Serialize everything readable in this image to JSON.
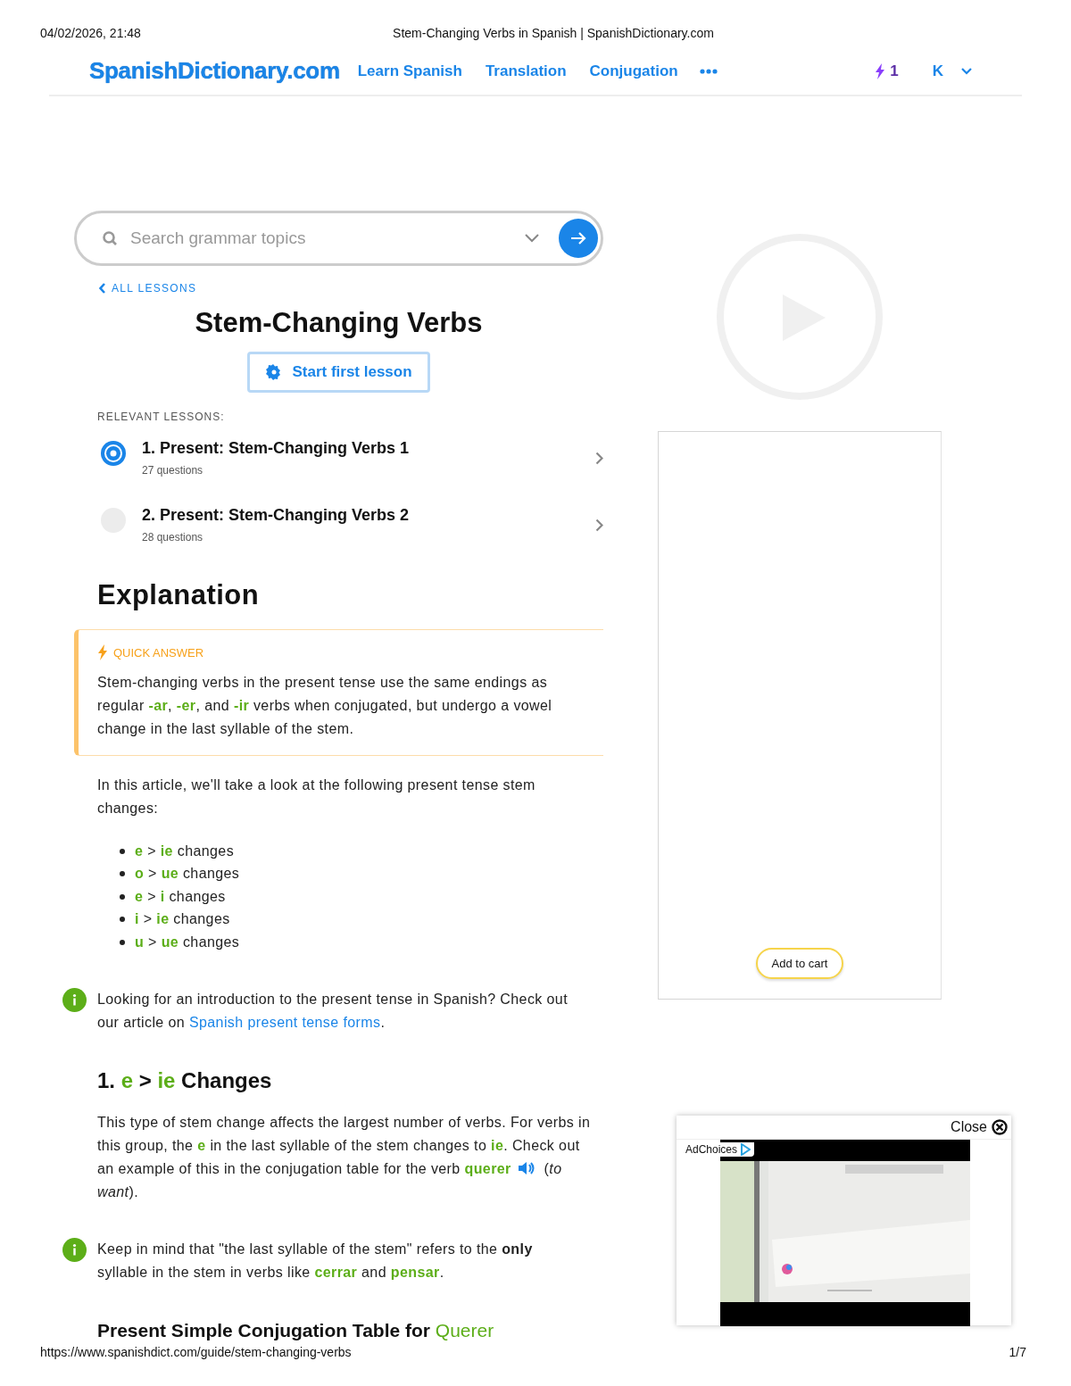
{
  "print_header": {
    "date": "04/02/2026, 21:48",
    "title": "Stem-Changing Verbs in Spanish | SpanishDictionary.com"
  },
  "nav": {
    "logo": "SpanishDictionary.com",
    "links": [
      "Learn Spanish",
      "Translation",
      "Conjugation"
    ],
    "streak": "1",
    "avatar": "K"
  },
  "search": {
    "placeholder": "Search grammar topics"
  },
  "back_link": "ALL LESSONS",
  "title": "Stem-Changing Verbs",
  "start_button": "Start first lesson",
  "relevant_label": "RELEVANT LESSONS:",
  "lessons": [
    {
      "title": "1. Present: Stem-Changing Verbs 1",
      "questions": "27 questions",
      "selected": true
    },
    {
      "title": "2. Present: Stem-Changing Verbs 2",
      "questions": "28 questions",
      "selected": false
    }
  ],
  "explanation": {
    "heading": "Explanation",
    "quick_answer": {
      "label": "QUICK ANSWER",
      "text": [
        {
          "kind": "plain",
          "text": "Stem-changing verbs in the present tense use the same endings as regular "
        },
        {
          "kind": "term",
          "text": "-ar"
        },
        {
          "kind": "plain",
          "text": ", "
        },
        {
          "kind": "term",
          "text": "-er"
        },
        {
          "kind": "plain",
          "text": ", and "
        },
        {
          "kind": "term",
          "text": "-ir"
        },
        {
          "kind": "plain",
          "text": " verbs when conjugated, but undergo a vowel change in the last syllable of the stem."
        }
      ]
    },
    "blocks": [
      {
        "kind": "paragraph",
        "text": [
          {
            "kind": "plain",
            "text": "In this article, we'll take a look at the following present tense stem changes:"
          }
        ]
      },
      {
        "kind": "list",
        "items": [
          [
            {
              "kind": "term",
              "text": "e"
            },
            {
              "kind": "plain",
              "text": " > "
            },
            {
              "kind": "term",
              "text": "ie"
            },
            {
              "kind": "plain",
              "text": " changes"
            }
          ],
          [
            {
              "kind": "term",
              "text": "o"
            },
            {
              "kind": "plain",
              "text": " > "
            },
            {
              "kind": "term",
              "text": "ue"
            },
            {
              "kind": "plain",
              "text": " changes"
            }
          ],
          [
            {
              "kind": "term",
              "text": "e"
            },
            {
              "kind": "plain",
              "text": " > "
            },
            {
              "kind": "term",
              "text": "i"
            },
            {
              "kind": "plain",
              "text": " changes"
            }
          ],
          [
            {
              "kind": "term",
              "text": "i"
            },
            {
              "kind": "plain",
              "text": " > "
            },
            {
              "kind": "term",
              "text": "ie"
            },
            {
              "kind": "plain",
              "text": " changes"
            }
          ],
          [
            {
              "kind": "term",
              "text": "u"
            },
            {
              "kind": "plain",
              "text": " > "
            },
            {
              "kind": "term",
              "text": "ue"
            },
            {
              "kind": "plain",
              "text": " changes"
            }
          ]
        ]
      },
      {
        "kind": "tip",
        "text": [
          {
            "kind": "plain",
            "text": "Looking for an introduction to the present tense in Spanish? Check out our article on "
          },
          {
            "kind": "link",
            "text": "Spanish present tense forms"
          },
          {
            "kind": "plain",
            "text": "."
          }
        ]
      },
      {
        "kind": "heading",
        "text": [
          {
            "kind": "plain",
            "text": "1. "
          },
          {
            "kind": "term",
            "text": "e"
          },
          {
            "kind": "plain",
            "text": " > "
          },
          {
            "kind": "term",
            "text": "ie"
          },
          {
            "kind": "plain",
            "text": " Changes"
          }
        ]
      },
      {
        "kind": "paragraph",
        "text": [
          {
            "kind": "plain",
            "text": "This type of stem change affects the largest number of verbs. For verbs in this group, the "
          },
          {
            "kind": "term",
            "text": "e"
          },
          {
            "kind": "plain",
            "text": " in the last syllable of the stem changes to "
          },
          {
            "kind": "term",
            "text": "ie"
          },
          {
            "kind": "plain",
            "text": ". Check out an example of this in the conjugation table for the verb "
          },
          {
            "kind": "term",
            "text": "querer"
          },
          {
            "kind": "audio"
          },
          {
            "kind": "plain",
            "text": " ("
          },
          {
            "kind": "italic",
            "text": "to want"
          },
          {
            "kind": "plain",
            "text": ")."
          }
        ]
      },
      {
        "kind": "tip",
        "text": [
          {
            "kind": "plain",
            "text": "Keep in mind that \"the last syllable of the stem\" refers to the "
          },
          {
            "kind": "bold",
            "text": "only"
          },
          {
            "kind": "plain",
            "text": " syllable in the stem in verbs like "
          },
          {
            "kind": "term",
            "text": "cerrar"
          },
          {
            "kind": "plain",
            "text": " and "
          },
          {
            "kind": "term",
            "text": "pensar"
          },
          {
            "kind": "plain",
            "text": "."
          }
        ]
      },
      {
        "kind": "subheading",
        "text": [
          {
            "kind": "plain",
            "text": "Present Simple Conjugation Table for "
          },
          {
            "kind": "term",
            "text": "Querer"
          }
        ]
      }
    ]
  },
  "sidebar": {
    "add_to_cart": "Add to cart"
  },
  "video_ad": {
    "close": "Close",
    "adchoices": "AdChoices",
    "kind": "picture"
  },
  "print_footer": {
    "url": "https://www.spanishdict.com/guide/stem-changing-verbs",
    "page": "1/7"
  }
}
